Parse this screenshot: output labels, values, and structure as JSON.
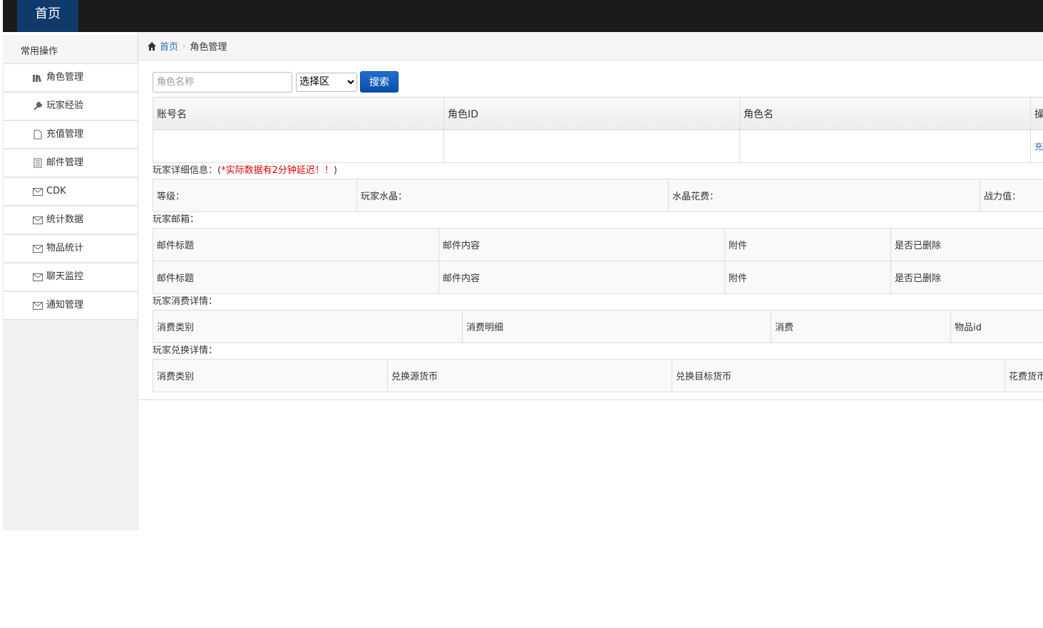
{
  "topbar": {
    "home_tab": "首页"
  },
  "sidebar": {
    "group_title": "常用操作",
    "items": [
      {
        "label": "角色管理",
        "icon": "books-icon"
      },
      {
        "label": "玩家经验",
        "icon": "wrench-icon"
      },
      {
        "label": "充值管理",
        "icon": "document-icon"
      },
      {
        "label": "邮件管理",
        "icon": "list-icon"
      },
      {
        "label": "CDK",
        "icon": "envelope-icon"
      },
      {
        "label": "统计数据",
        "icon": "envelope-icon"
      },
      {
        "label": "物品统计",
        "icon": "envelope-icon"
      },
      {
        "label": "聊天监控",
        "icon": "envelope-icon"
      },
      {
        "label": "通知管理",
        "icon": "envelope-icon"
      }
    ]
  },
  "breadcrumb": {
    "home": "首页",
    "current": "角色管理"
  },
  "search": {
    "placeholder": "角色名称",
    "select_value": "选择区",
    "button": "搜索"
  },
  "role_table": {
    "headers": [
      "账号名",
      "角色ID",
      "角色名",
      "操"
    ],
    "row": [
      "",
      "",
      "",
      "充"
    ]
  },
  "detail": {
    "label_prefix": "玩家详细信息：(",
    "warning": "*实际数据有2分钟延迟！！",
    "label_suffix": ")",
    "fields": [
      "等级：",
      "玩家水晶：",
      "水晶花费：",
      "战力值："
    ]
  },
  "mail": {
    "label": "玩家邮箱：",
    "rows": [
      [
        "邮件标题",
        "邮件内容",
        "附件",
        "是否已删除"
      ],
      [
        "邮件标题",
        "邮件内容",
        "附件",
        "是否已删除"
      ]
    ]
  },
  "consume": {
    "label": "玩家消费详情：",
    "headers": [
      "消费类别",
      "消费明细",
      "消费",
      "物品id"
    ]
  },
  "exchange": {
    "label": "玩家兑换详情：",
    "headers": [
      "消费类别",
      "兑换源货币",
      "兑换目标货币",
      "花费货币"
    ]
  }
}
